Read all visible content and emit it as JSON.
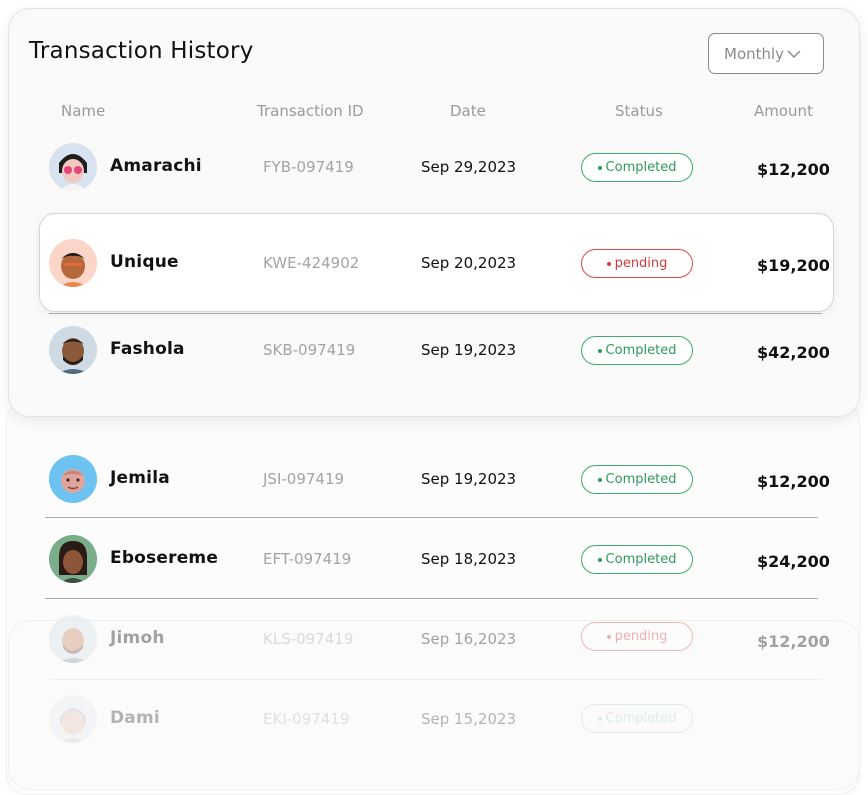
{
  "title": "Transaction History",
  "filter": {
    "selected": "Monthly"
  },
  "columns": [
    "Name",
    "Transaction ID",
    "Date",
    "Status",
    "Amount"
  ],
  "colors": {
    "completed": "#2e9a5b",
    "pending": "#d43a3a"
  },
  "rows": [
    {
      "name": "Amarachi",
      "id": "FYB-097419",
      "date": "Sep 29,2023",
      "status": "Completed",
      "status_type": "completed",
      "amount": "$12,200"
    },
    {
      "name": "Unique",
      "id": "KWE-424902",
      "date": "Sep 20,2023",
      "status": "pending",
      "status_type": "pending",
      "amount": "$19,200"
    },
    {
      "name": "Fashola",
      "id": "SKB-097419",
      "date": "Sep 19,2023",
      "status": "Completed",
      "status_type": "completed",
      "amount": "$42,200"
    },
    {
      "name": "Jemila",
      "id": "JSI-097419",
      "date": "Sep 19,2023",
      "status": "Completed",
      "status_type": "completed",
      "amount": "$12,200"
    },
    {
      "name": "Ebosereme",
      "id": "EFT-097419",
      "date": "Sep 18,2023",
      "status": "Completed",
      "status_type": "completed",
      "amount": "$24,200"
    },
    {
      "name": "Jimoh",
      "id": "KLS-097419",
      "date": "Sep 16,2023",
      "status": "pending",
      "status_type": "pending",
      "amount": "$12,200"
    },
    {
      "name": "Dami",
      "id": "EKI-097419",
      "date": "Sep 15,2023",
      "status": "Completed",
      "status_type": "completed",
      "amount": ""
    }
  ]
}
